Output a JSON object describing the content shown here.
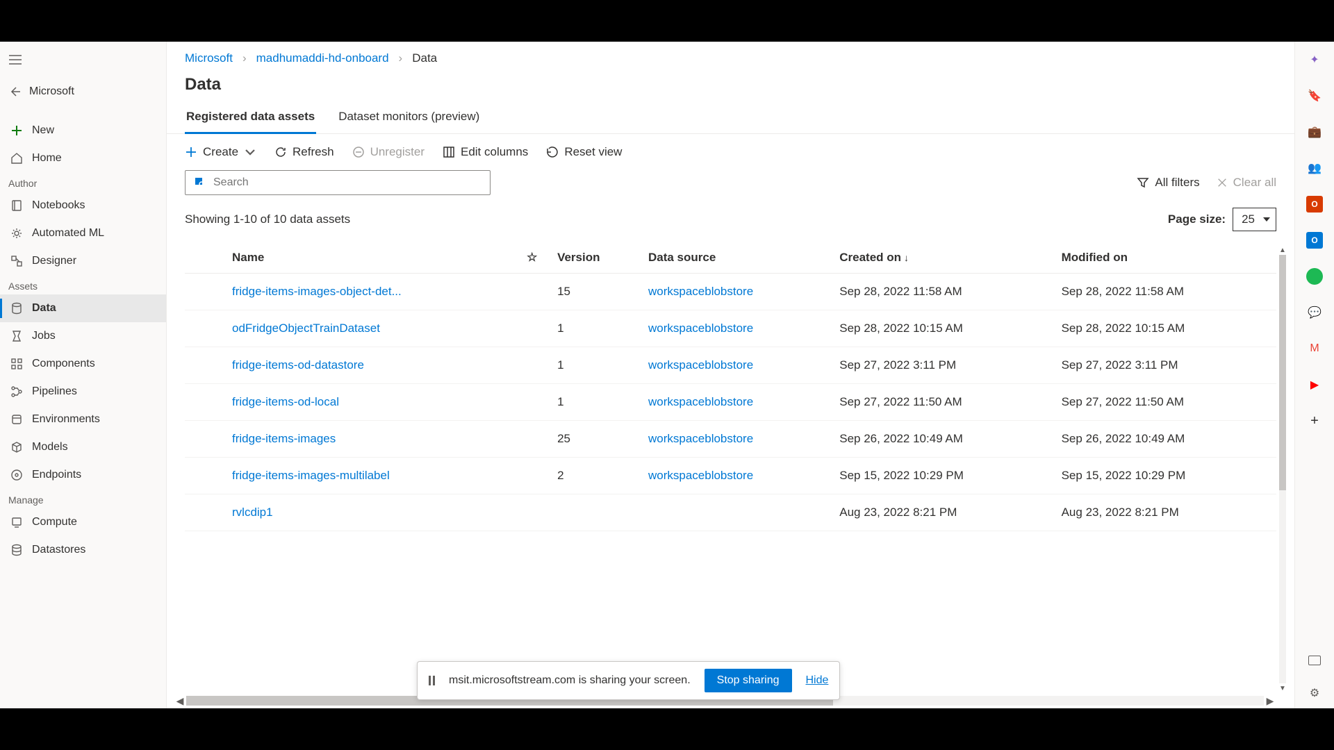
{
  "workspace_back_label": "Microsoft",
  "breadcrumb": {
    "root": "Microsoft",
    "workspace": "madhumaddi-hd-onboard",
    "current": "Data"
  },
  "page_title": "Data",
  "sidebar": {
    "new": "New",
    "home": "Home",
    "section_author": "Author",
    "notebooks": "Notebooks",
    "automl": "Automated ML",
    "designer": "Designer",
    "section_assets": "Assets",
    "data": "Data",
    "jobs": "Jobs",
    "components": "Components",
    "pipelines": "Pipelines",
    "environments": "Environments",
    "models": "Models",
    "endpoints": "Endpoints",
    "section_manage": "Manage",
    "compute": "Compute",
    "datastores": "Datastores"
  },
  "tabs": {
    "registered": "Registered data assets",
    "monitors": "Dataset monitors (preview)"
  },
  "toolbar": {
    "create": "Create",
    "refresh": "Refresh",
    "unregister": "Unregister",
    "edit_columns": "Edit columns",
    "reset_view": "Reset view"
  },
  "search_placeholder": "Search",
  "filters": {
    "all": "All filters",
    "clear": "Clear all"
  },
  "status_text": "Showing 1-10 of 10 data assets",
  "page_size_label": "Page size:",
  "page_size_value": "25",
  "columns": {
    "name": "Name",
    "version": "Version",
    "data_source": "Data source",
    "created": "Created on",
    "modified": "Modified on"
  },
  "rows": [
    {
      "name": "fridge-items-images-object-det...",
      "version": "15",
      "source": "workspaceblobstore",
      "created": "Sep 28, 2022 11:58 AM",
      "modified": "Sep 28, 2022 11:58 AM"
    },
    {
      "name": "odFridgeObjectTrainDataset",
      "version": "1",
      "source": "workspaceblobstore",
      "created": "Sep 28, 2022 10:15 AM",
      "modified": "Sep 28, 2022 10:15 AM"
    },
    {
      "name": "fridge-items-od-datastore",
      "version": "1",
      "source": "workspaceblobstore",
      "created": "Sep 27, 2022 3:11 PM",
      "modified": "Sep 27, 2022 3:11 PM"
    },
    {
      "name": "fridge-items-od-local",
      "version": "1",
      "source": "workspaceblobstore",
      "created": "Sep 27, 2022 11:50 AM",
      "modified": "Sep 27, 2022 11:50 AM"
    },
    {
      "name": "fridge-items-images",
      "version": "25",
      "source": "workspaceblobstore",
      "created": "Sep 26, 2022 10:49 AM",
      "modified": "Sep 26, 2022 10:49 AM"
    },
    {
      "name": "fridge-items-images-multilabel",
      "version": "2",
      "source": "workspaceblobstore",
      "created": "Sep 15, 2022 10:29 PM",
      "modified": "Sep 15, 2022 10:29 PM"
    },
    {
      "name": "rvlcdip1",
      "version": "",
      "source": "",
      "created": "Aug 23, 2022 8:21 PM",
      "modified": "Aug 23, 2022 8:21 PM"
    }
  ],
  "share": {
    "text": "msit.microsoftstream.com is sharing your screen.",
    "stop": "Stop sharing",
    "hide": "Hide"
  }
}
